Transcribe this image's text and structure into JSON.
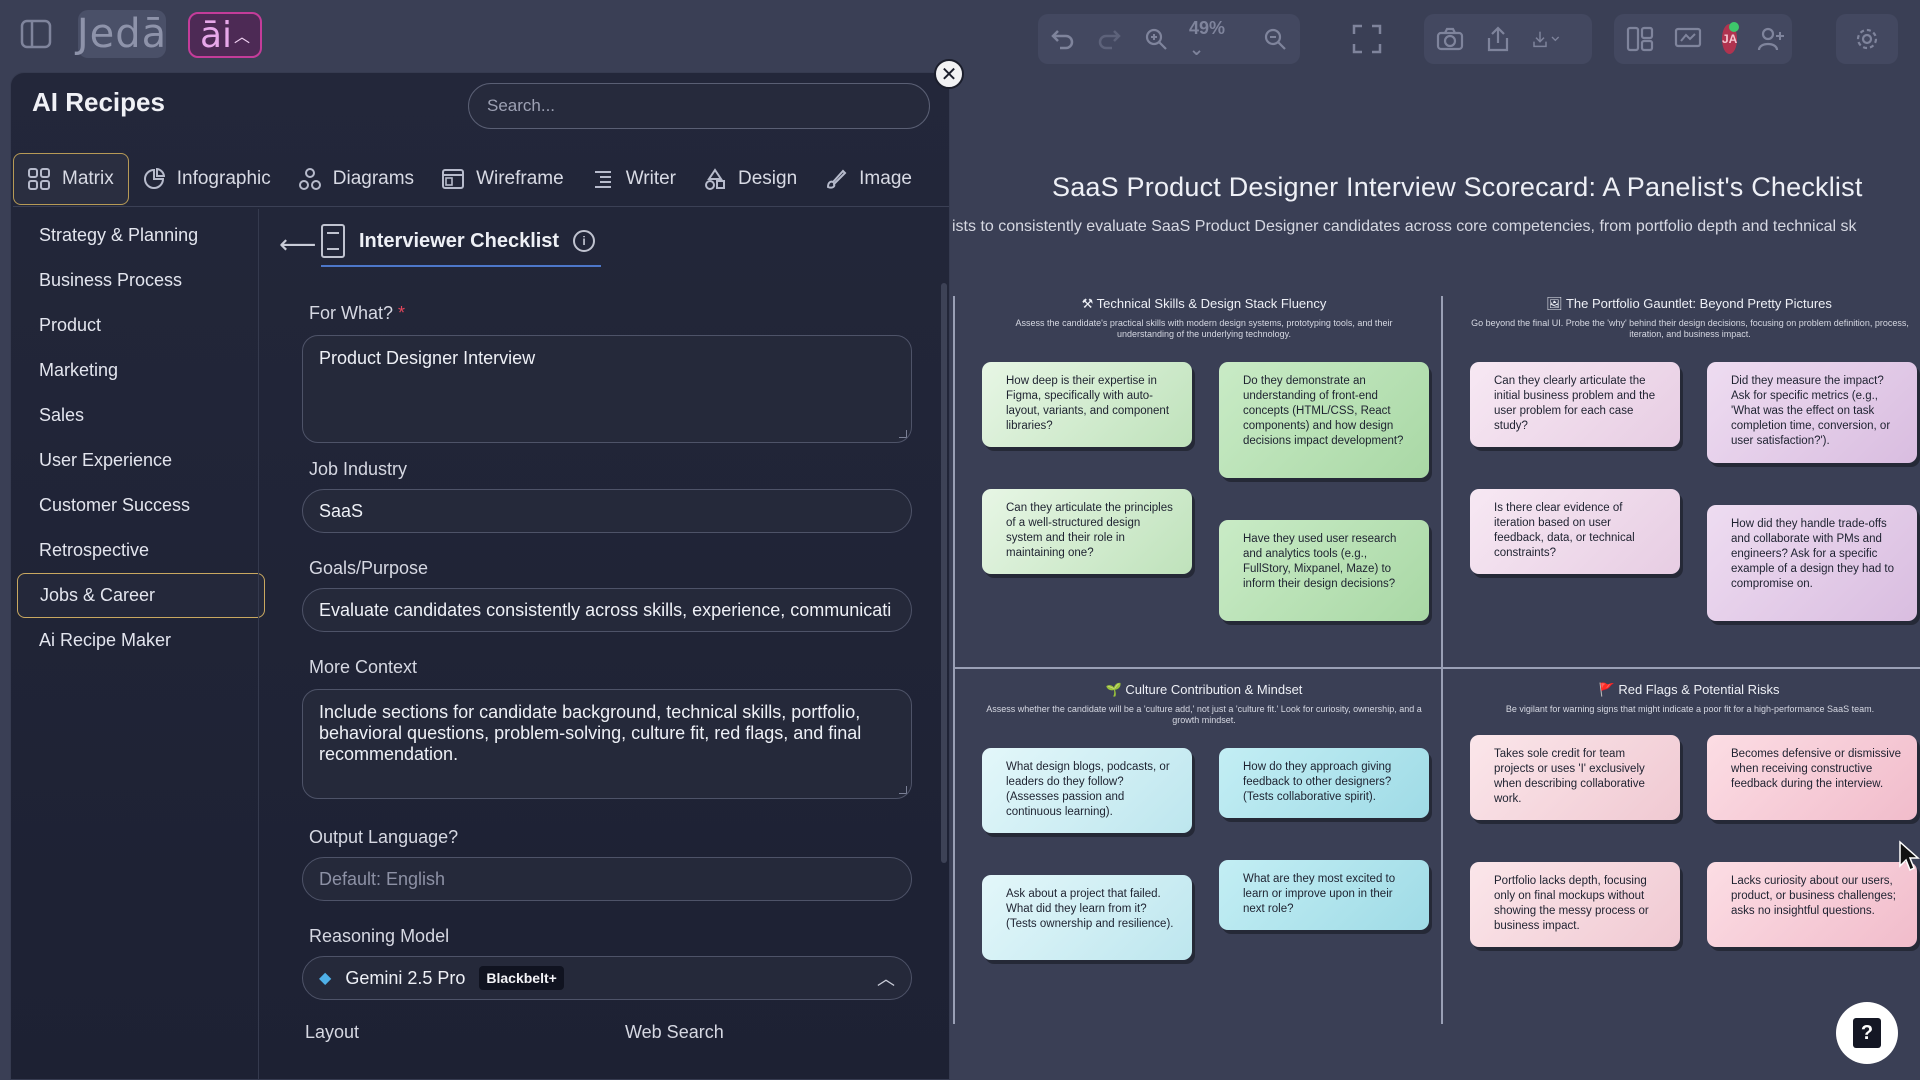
{
  "topbar": {
    "logo_text": "Jedā",
    "ai_label": "āi",
    "zoom": "49%",
    "avatar_initials": "JA"
  },
  "panel": {
    "title": "AI Recipes",
    "search_placeholder": "Search...",
    "close_symbol": "✕",
    "tabs": [
      {
        "label": "Matrix",
        "icon": "grid-icon"
      },
      {
        "label": "Infographic",
        "icon": "pie-chart-icon"
      },
      {
        "label": "Diagrams",
        "icon": "diagram-icon"
      },
      {
        "label": "Wireframe",
        "icon": "wireframe-icon"
      },
      {
        "label": "Writer",
        "icon": "writer-icon"
      },
      {
        "label": "Design",
        "icon": "design-icon"
      },
      {
        "label": "Image",
        "icon": "image-brush-icon"
      }
    ],
    "categories": [
      "Strategy & Planning",
      "Business Process",
      "Product",
      "Marketing",
      "Sales",
      "User Experience",
      "Customer Success",
      "Retrospective",
      "Jobs & Career",
      "Ai Recipe Maker"
    ],
    "active_category": "Jobs & Career",
    "recipe_title": "Interviewer Checklist",
    "form": {
      "for_what_label": "For What?",
      "for_what_required": "*",
      "for_what_value": "Product Designer Interview",
      "industry_label": "Job Industry",
      "industry_value": "SaaS",
      "goals_label": "Goals/Purpose",
      "goals_value": "Evaluate candidates consistently across skills, experience, communicati",
      "context_label": "More Context",
      "context_value": "Include sections for candidate background, technical skills, portfolio, behavioral questions, problem-solving, culture fit, red flags, and final recommendation.",
      "language_label": "Output Language?",
      "language_placeholder": "Default: English",
      "model_label": "Reasoning Model",
      "model_value": "Gemini 2.5 Pro",
      "model_badge": "Blackbelt+",
      "layout_label": "Layout",
      "websearch_label": "Web Search"
    }
  },
  "canvas": {
    "title": "SaaS Product Designer Interview Scorecard: A Panelist's Checklist",
    "subtitle": "ists to consistently evaluate SaaS Product Designer candidates across core competencies, from portfolio depth and technical sk",
    "quadrants": [
      {
        "heading": "⚒ Technical Skills & Design Stack Fluency",
        "description": "Assess the candidate's practical skills with modern design systems, prototyping tools, and their understanding of the underlying technology.",
        "notes": [
          "How deep is their expertise in Figma, specifically with auto-layout, variants, and component libraries?",
          "Do they demonstrate an understanding of front-end concepts (HTML/CSS, React components) and how design decisions impact development?",
          "Can they articulate the principles of a well-structured design system and their role in maintaining one?",
          "Have they used user research and analytics tools (e.g., FullStory, Mixpanel, Maze) to inform their design decisions?"
        ]
      },
      {
        "heading": "🖼 The Portfolio Gauntlet: Beyond Pretty Pictures",
        "description": "Go beyond the final UI. Probe the 'why' behind their design decisions, focusing on problem definition, process, iteration, and business impact.",
        "notes": [
          "Can they clearly articulate the initial business problem and the user problem for each case study?",
          "Did they measure the impact? Ask for specific metrics (e.g., 'What was the effect on task completion time, conversion, or user satisfaction?').",
          "Is there clear evidence of iteration based on user feedback, data, or technical constraints?",
          "How did they handle trade-offs and collaborate with PMs and engineers? Ask for a specific example of a design they had to compromise on."
        ]
      },
      {
        "heading": "🌱 Culture Contribution & Mindset",
        "description": "Assess whether the candidate will be a 'culture add,' not just a 'culture fit.' Look for curiosity, ownership, and a growth mindset.",
        "notes": [
          "What design blogs, podcasts, or leaders do they follow? (Assesses passion and continuous learning).",
          "How do they approach giving feedback to other designers? (Tests collaborative spirit).",
          "Ask about a project that failed. What did they learn from it? (Tests ownership and resilience).",
          "What are they most excited to learn or improve upon in their next role?"
        ]
      },
      {
        "heading": "🚩 Red Flags & Potential Risks",
        "description": "Be vigilant for warning signs that might indicate a poor fit for a high-performance SaaS team.",
        "notes": [
          "Takes sole credit for team projects or uses 'I' exclusively when describing collaborative work.",
          "Becomes defensive or dismissive when receiving constructive feedback during the interview.",
          "Portfolio lacks depth, focusing only on final mockups without showing the messy process or business impact.",
          "Lacks curiosity about our users, product, or business challenges; asks no insightful questions."
        ]
      }
    ]
  },
  "help_symbol": "?"
}
